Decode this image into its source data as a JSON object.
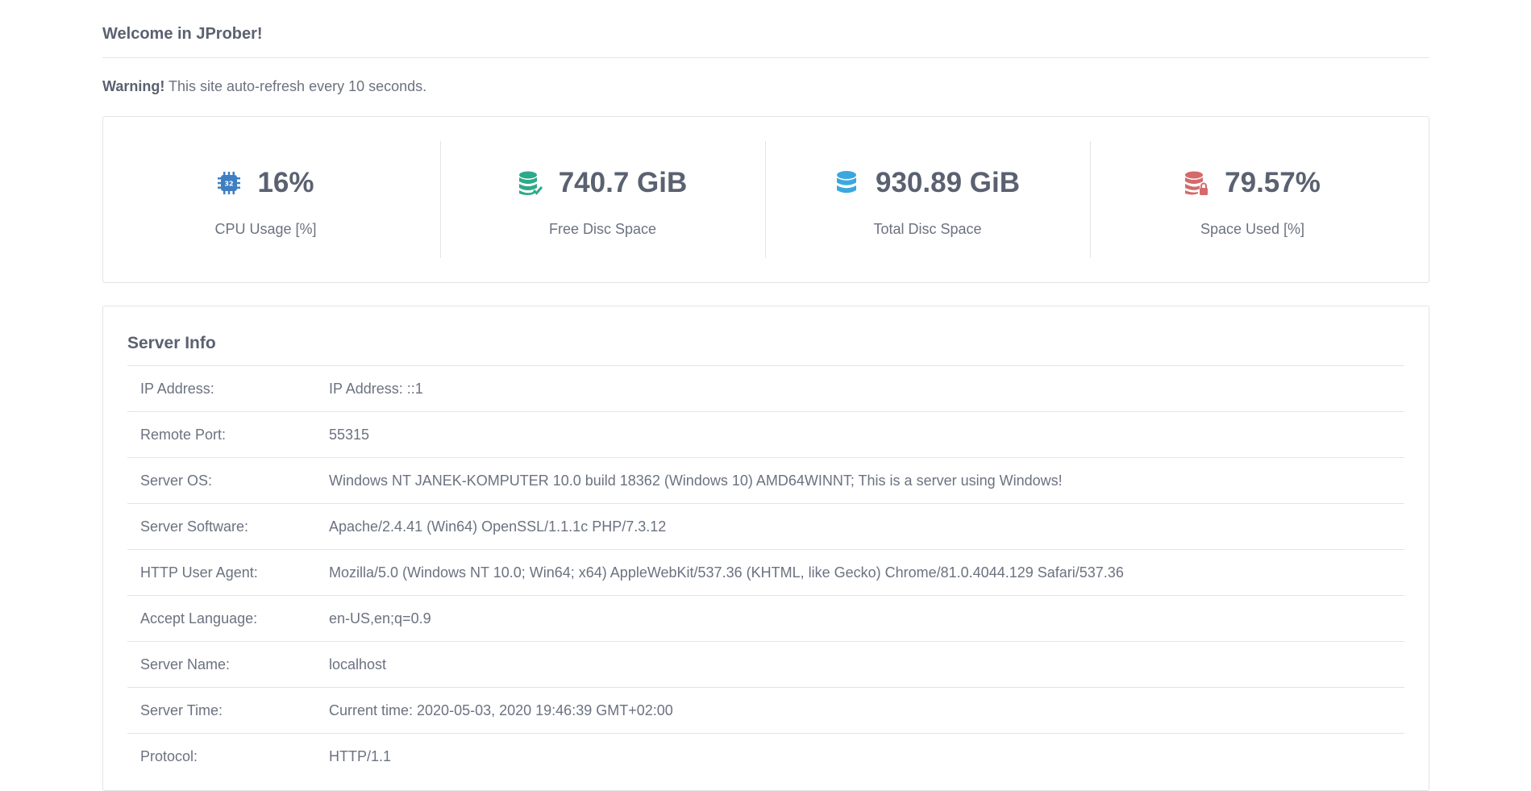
{
  "header": {
    "welcome": "Welcome in JProber!",
    "warning_strong": "Warning!",
    "warning_text": " This site auto-refresh every 10 seconds."
  },
  "stats": [
    {
      "icon": "cpu-chip-icon",
      "color": "#3f7fc1",
      "value": "16%",
      "label": "CPU Usage [%]"
    },
    {
      "icon": "database-check-icon",
      "color": "#2daa8a",
      "value": "740.7 GiB",
      "label": "Free Disc Space"
    },
    {
      "icon": "database-icon",
      "color": "#3ba8dd",
      "value": "930.89 GiB",
      "label": "Total Disc Space"
    },
    {
      "icon": "database-lock-icon",
      "color": "#d46a6a",
      "value": "79.57%",
      "label": "Space Used [%]"
    }
  ],
  "server_info": {
    "title": "Server Info",
    "rows": [
      {
        "key": "IP Address:",
        "value": "IP Address: ::1"
      },
      {
        "key": "Remote Port:",
        "value": "55315"
      },
      {
        "key": "Server OS:",
        "value": "Windows NT JANEK-KOMPUTER 10.0 build 18362 (Windows 10) AMD64WINNT; This is a server using Windows!"
      },
      {
        "key": "Server Software:",
        "value": "Apache/2.4.41 (Win64) OpenSSL/1.1.1c PHP/7.3.12"
      },
      {
        "key": "HTTP User Agent:",
        "value": "Mozilla/5.0 (Windows NT 10.0; Win64; x64) AppleWebKit/537.36 (KHTML, like Gecko) Chrome/81.0.4044.129 Safari/537.36"
      },
      {
        "key": "Accept Language:",
        "value": "en-US,en;q=0.9"
      },
      {
        "key": "Server Name:",
        "value": "localhost"
      },
      {
        "key": "Server Time:",
        "value": "Current time: 2020-05-03, 2020 19:46:39 GMT+02:00"
      },
      {
        "key": "Protocol:",
        "value": "HTTP/1.1"
      }
    ]
  }
}
